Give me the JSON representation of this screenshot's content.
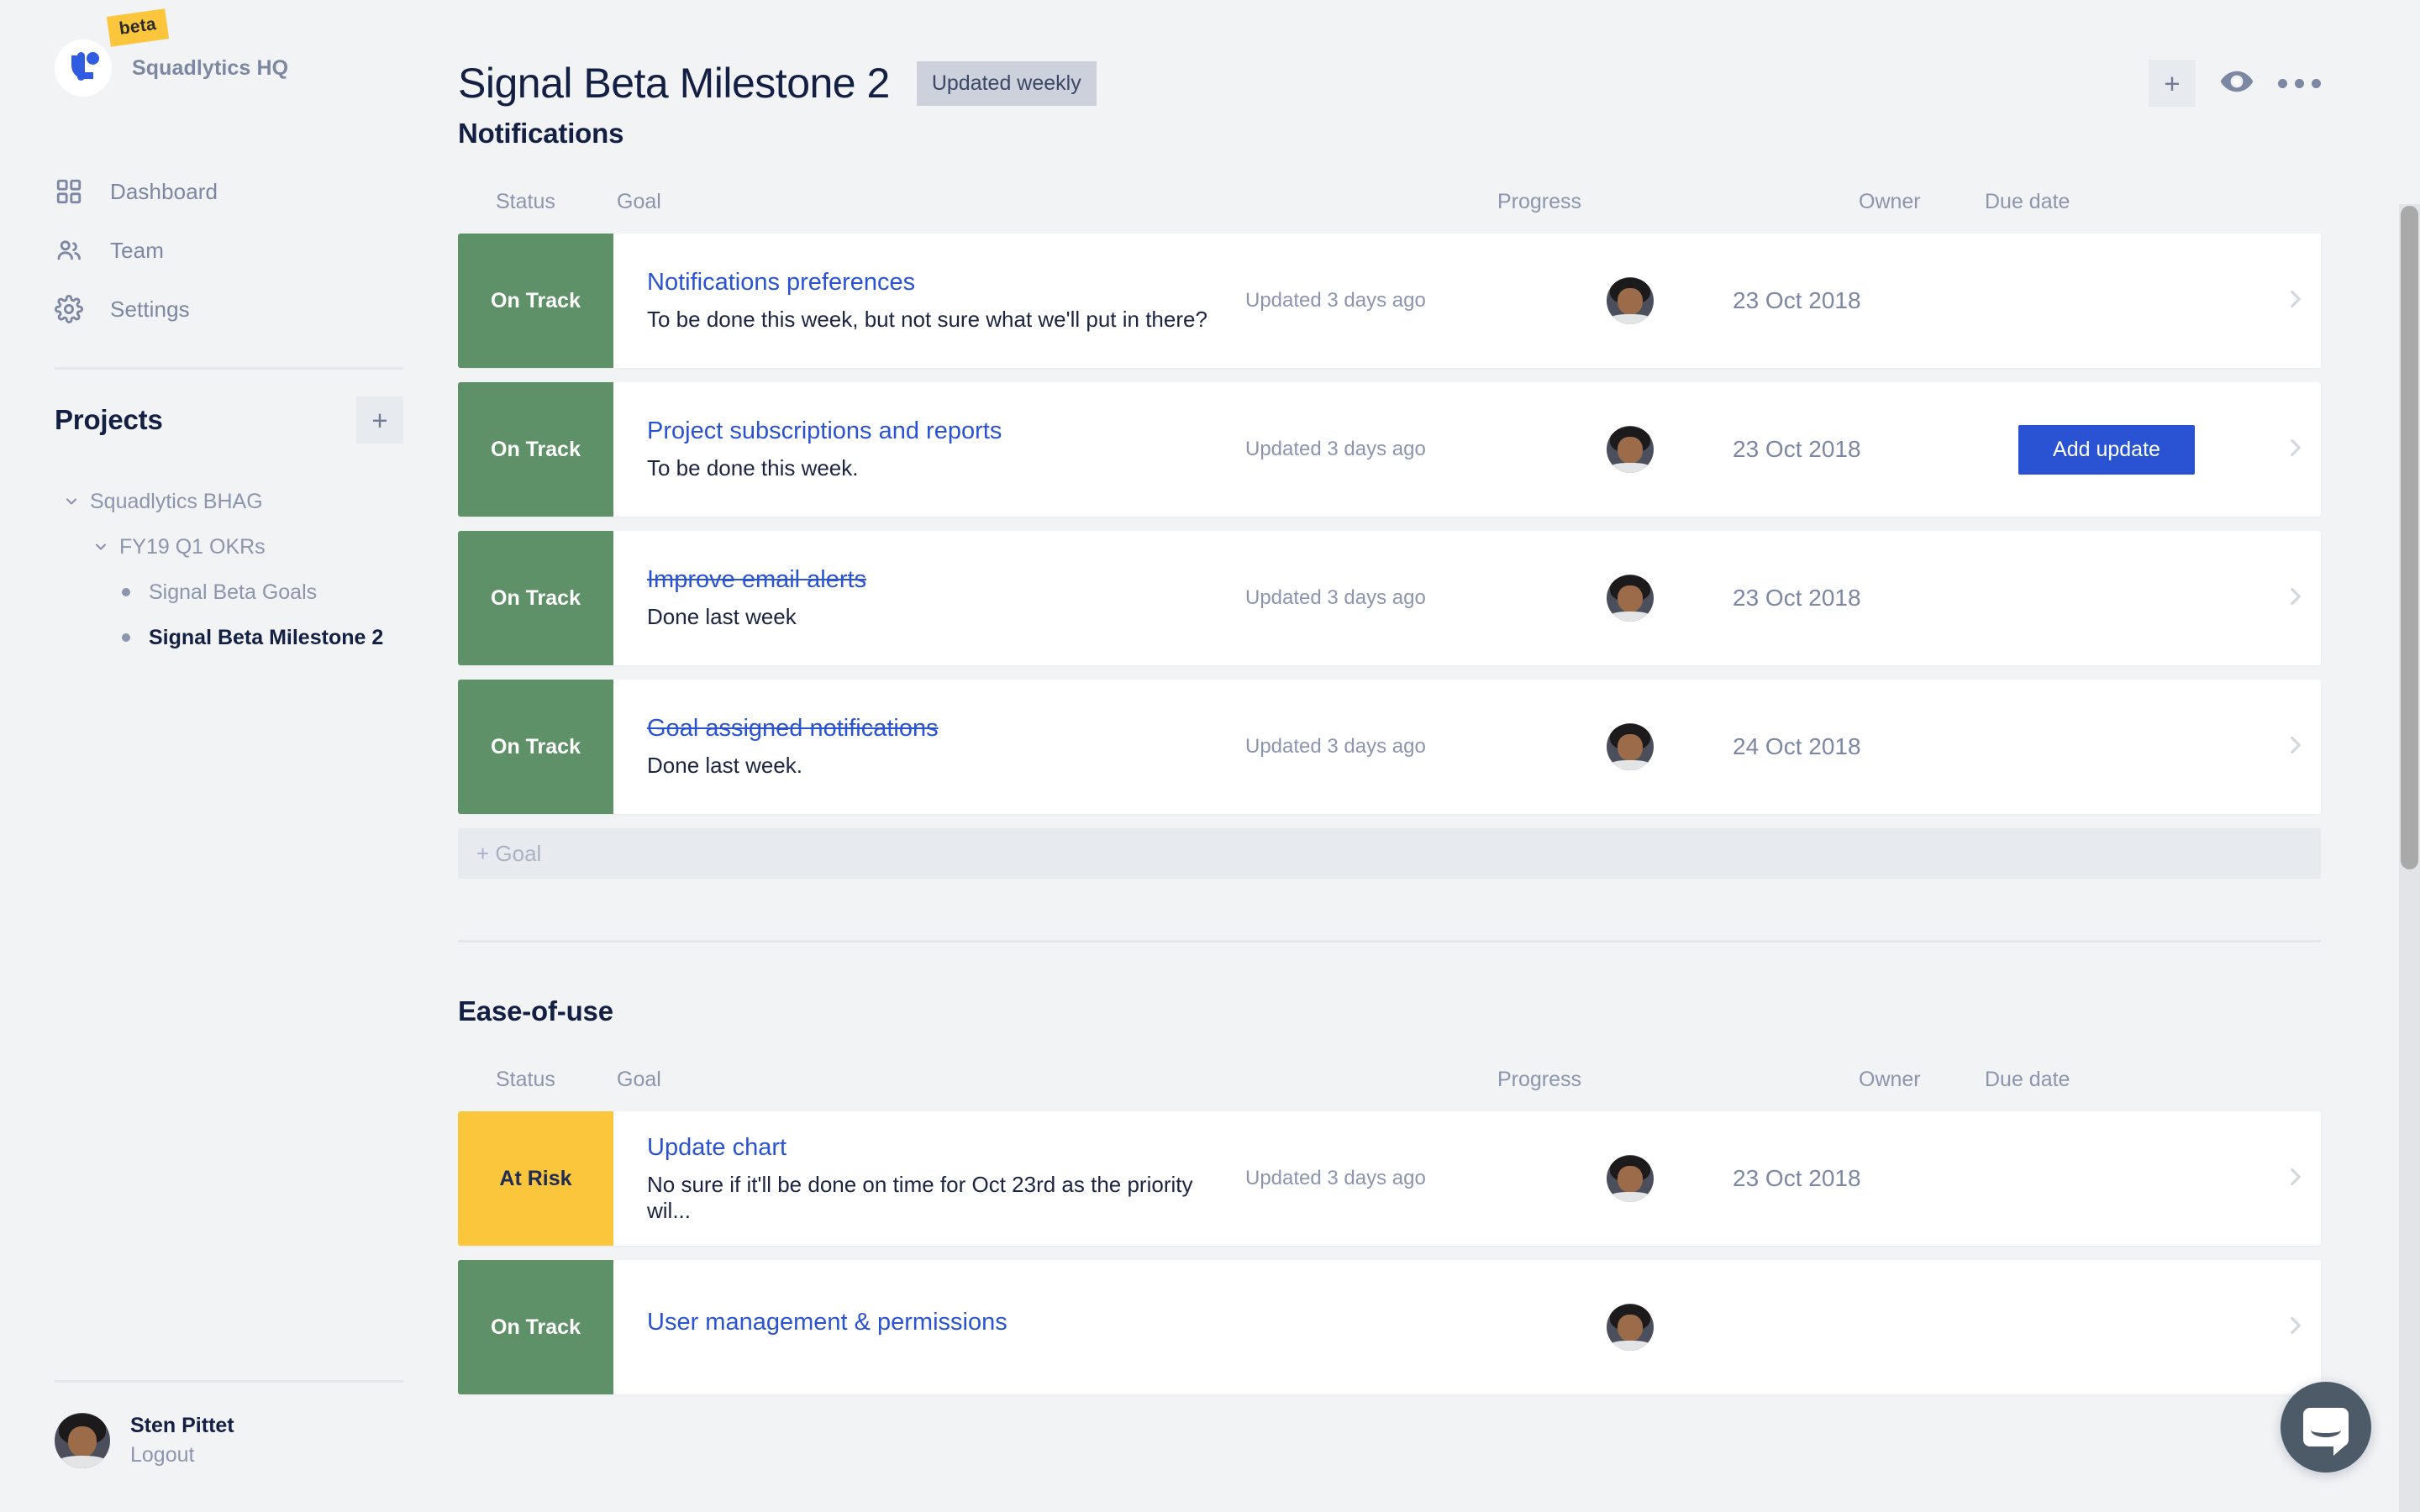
{
  "sidebar": {
    "brand": {
      "name": "Squadlytics HQ",
      "badge": "beta",
      "logo_icon": "squadlytics-logo-icon"
    },
    "nav": [
      {
        "label": "Dashboard",
        "icon": "grid-icon"
      },
      {
        "label": "Team",
        "icon": "people-icon"
      },
      {
        "label": "Settings",
        "icon": "gear-icon"
      }
    ],
    "projects": {
      "title": "Projects",
      "add_label": "+",
      "tree": [
        {
          "label": "Squadlytics BHAG",
          "level": 1,
          "type": "caret",
          "active": false
        },
        {
          "label": "FY19 Q1 OKRs",
          "level": 2,
          "type": "caret",
          "active": false
        },
        {
          "label": "Signal Beta Goals",
          "level": 3,
          "type": "bullet",
          "active": false
        },
        {
          "label": "Signal Beta Milestone 2",
          "level": 3,
          "type": "bullet",
          "active": true
        }
      ]
    },
    "user": {
      "name": "Sten Pittet",
      "logout_label": "Logout",
      "avatar": "user-avatar"
    }
  },
  "header": {
    "title": "Signal Beta Milestone 2",
    "badge": "Updated weekly",
    "actions": [
      {
        "name": "add-button",
        "icon": "plus-icon",
        "label": "+"
      },
      {
        "name": "watch-button",
        "icon": "eye-icon"
      },
      {
        "name": "more-button",
        "icon": "ellipsis-icon"
      }
    ]
  },
  "columns": {
    "status": "Status",
    "goal": "Goal",
    "progress": "Progress",
    "owner": "Owner",
    "due_date": "Due date"
  },
  "add_goal_label": "+ Goal",
  "colors": {
    "on_track": "#5f9168",
    "at_risk": "#fbc53c",
    "accent": "#2a53d4",
    "link": "#2a53d4",
    "beta_badge": "#fbc53c",
    "page_bg": "#f1f3f5"
  },
  "sections": [
    {
      "title": "Notifications",
      "rows": [
        {
          "status": "On Track",
          "status_kind": "ontrack",
          "title": "Notifications preferences",
          "done": false,
          "subtitle": "To be done this week, but not sure what we'll put in there?",
          "progress": "Updated 3 days ago",
          "due_date": "23 Oct 2018",
          "action": null
        },
        {
          "status": "On Track",
          "status_kind": "ontrack",
          "title": "Project subscriptions and reports",
          "done": false,
          "subtitle": "To be done this week.",
          "progress": "Updated 3 days ago",
          "due_date": "23 Oct 2018",
          "action": "Add update"
        },
        {
          "status": "On Track",
          "status_kind": "ontrack",
          "title": "Improve email alerts",
          "done": true,
          "subtitle": "Done last week",
          "progress": "Updated 3 days ago",
          "due_date": "23 Oct 2018",
          "action": null
        },
        {
          "status": "On Track",
          "status_kind": "ontrack",
          "title": "Goal assigned notifications",
          "done": true,
          "subtitle": "Done last week.",
          "progress": "Updated 3 days ago",
          "due_date": "24 Oct 2018",
          "action": null
        }
      ]
    },
    {
      "title": "Ease-of-use",
      "rows": [
        {
          "status": "At Risk",
          "status_kind": "atrisk",
          "title": "Update chart",
          "done": false,
          "subtitle": "No sure if it'll be done on time for Oct 23rd as the priority wil...",
          "progress": "Updated 3 days ago",
          "due_date": "23 Oct 2018",
          "action": null
        },
        {
          "status": "On Track",
          "status_kind": "ontrack",
          "title": "User management & permissions",
          "done": false,
          "subtitle": "",
          "progress": "",
          "due_date": "",
          "action": null
        }
      ]
    }
  ],
  "chat": {
    "icon": "chat-bubble-icon"
  }
}
